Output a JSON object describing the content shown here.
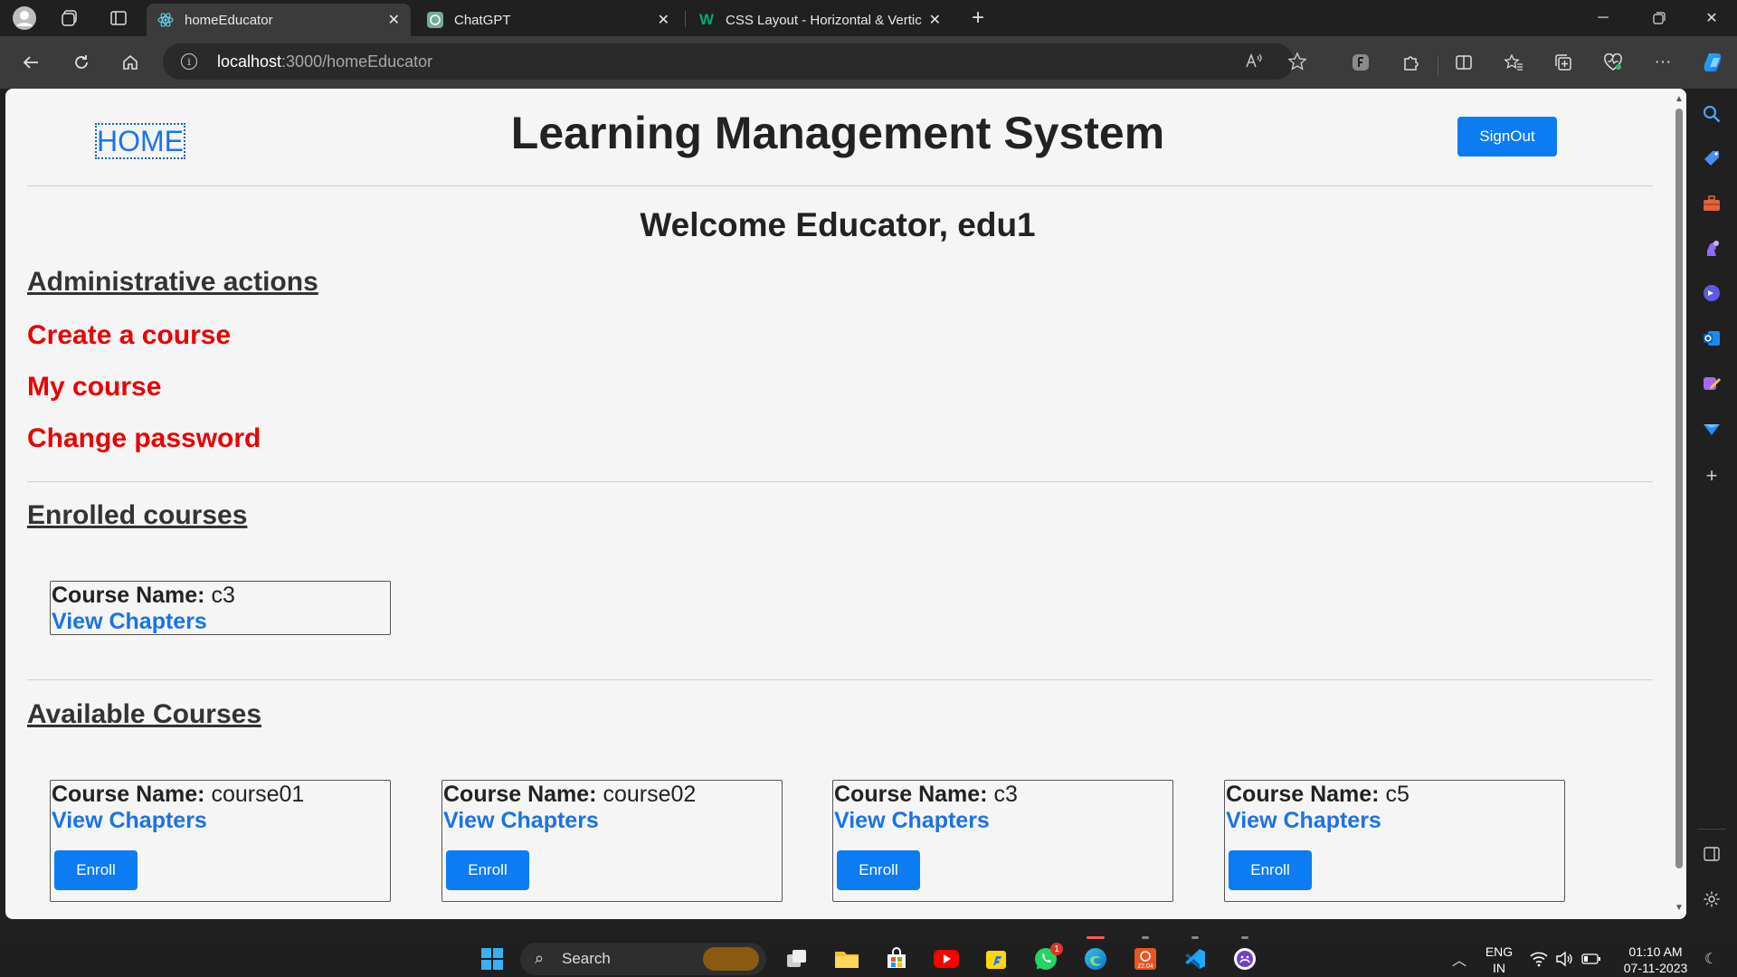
{
  "browser": {
    "tabs": [
      {
        "title": "homeEducator",
        "favicon": "react-icon"
      },
      {
        "title": "ChatGPT",
        "favicon": "chatgpt-icon"
      },
      {
        "title": "CSS Layout - Horizontal & Vertic",
        "favicon": "w3schools-icon"
      }
    ],
    "address": {
      "host": "localhost",
      "path": ":3000/homeEducator"
    },
    "read_aloud": "Aͅ"
  },
  "page": {
    "home_link": "HOME",
    "title": "Learning Management System",
    "signout_label": "SignOut",
    "welcome": "Welcome Educator, edu1",
    "admin_heading": "Administrative actions",
    "admin_actions": [
      "Create a course",
      "My course",
      "Change password"
    ],
    "enrolled_heading": "Enrolled courses",
    "enrolled_courses": [
      {
        "label": "Course Name:",
        "name": " c3",
        "link": "View Chapters"
      }
    ],
    "available_heading": "Available Courses",
    "available_courses": [
      {
        "label": "Course Name:",
        "name": " course01",
        "link": "View Chapters",
        "action": "Enroll"
      },
      {
        "label": "Course Name:",
        "name": " course02",
        "link": "View Chapters",
        "action": "Enroll"
      },
      {
        "label": "Course Name:",
        "name": " c3",
        "link": "View Chapters",
        "action": "Enroll"
      },
      {
        "label": "Course Name:",
        "name": " c5",
        "link": "View Chapters",
        "action": "Enroll"
      }
    ]
  },
  "taskbar": {
    "search_label": "Search",
    "whatsapp_badge": "1",
    "ubuntu_label": "22.04",
    "lang_top": "ENG",
    "lang_bottom": "IN",
    "time": "01:10 AM",
    "date": "07-11-2023"
  },
  "colors": {
    "accent": "#0d7cf2",
    "link": "#1a73e8",
    "danger": "#ea0000"
  }
}
